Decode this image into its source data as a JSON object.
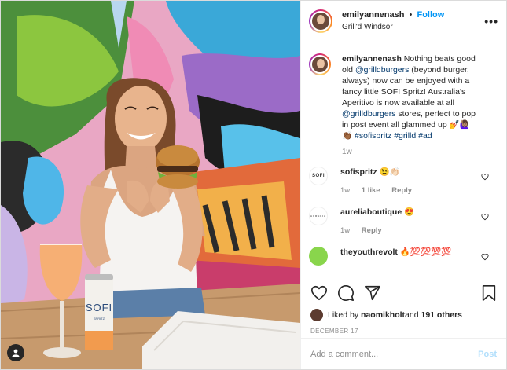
{
  "header": {
    "username": "emilyannenash",
    "separator": "•",
    "follow_label": "Follow",
    "location": "Grill'd Windsor",
    "more_glyph": "•••"
  },
  "caption": {
    "username": "emilyannenash",
    "segments": [
      {
        "type": "text",
        "text": " Nothing beats good old "
      },
      {
        "type": "mention",
        "text": "@grilldburgers"
      },
      {
        "type": "text",
        "text": " (beyond burger, always) now can be enjoyed with a fancy little SOFI Spritz! Australia's Aperitivo is now available at all "
      },
      {
        "type": "mention",
        "text": "@grilldburgers"
      },
      {
        "type": "text",
        "text": " stores, perfect to pop in post event all glammed up 💅🙋🏽‍♀️ 👏🏾 "
      },
      {
        "type": "hashtag",
        "text": "#sofispritz"
      },
      {
        "type": "text",
        "text": " "
      },
      {
        "type": "hashtag",
        "text": "#grilld"
      },
      {
        "type": "text",
        "text": " "
      },
      {
        "type": "hashtag",
        "text": "#ad"
      }
    ],
    "time": "1w"
  },
  "comments": [
    {
      "avatar_text": "SOFI",
      "username": "sofispritz",
      "text": "😉👏🏻",
      "time": "1w",
      "likes": "1 like",
      "reply": "Reply"
    },
    {
      "avatar_text": "AURELIA",
      "username": "aureliaboutique",
      "text": "😍",
      "time": "1w",
      "likes": "",
      "reply": "Reply"
    },
    {
      "avatar_text": "",
      "username": "theyouthrevolt",
      "text": "🔥💯💯💯💯",
      "time": "",
      "likes": "",
      "reply": ""
    }
  ],
  "actions": {
    "icons": [
      "heart-icon",
      "comment-icon",
      "share-icon",
      "bookmark-icon"
    ]
  },
  "likes": {
    "prefix": "Liked by ",
    "user": "naomikholt",
    "middle": " and ",
    "count": "191 others"
  },
  "date": "December 17",
  "add_comment": {
    "placeholder": "Add a comment...",
    "post_label": "Post"
  },
  "photo": {
    "can_brand": "SOFI",
    "can_sub": "SPRITZ"
  },
  "colors": {
    "link": "#0095f6",
    "mention": "#00376b",
    "muted": "#8e8e8e",
    "post_disabled": "#b2dffc"
  }
}
